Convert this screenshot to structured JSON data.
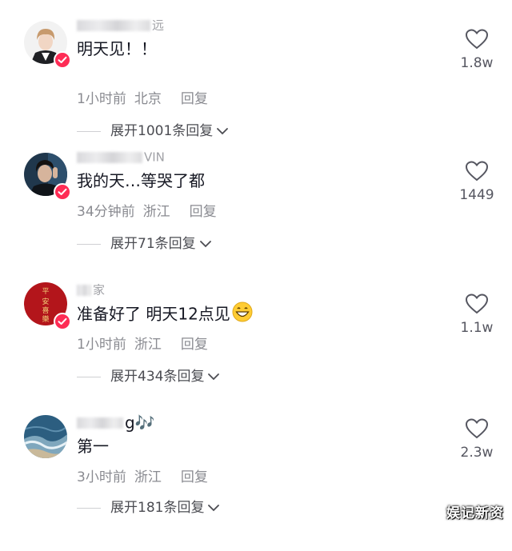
{
  "comments": [
    {
      "username_tail": "远",
      "text": "明天见！！",
      "time": "1小时前",
      "location": "北京",
      "reply_label": "回复",
      "expand_label": "展开1001条回复",
      "likes": "1.8w",
      "avatar": "young-man-portrait",
      "verified": true
    },
    {
      "username_tail": "VIN",
      "text": "我的天…等哭了都",
      "time": "34分钟前",
      "location": "浙江",
      "reply_label": "回复",
      "expand_label": "展开71条回复",
      "likes": "1449",
      "avatar": "man-dark-portrait",
      "verified": true
    },
    {
      "username_tail": "家",
      "text": "准备好了 明天12点见",
      "time": "1小时前",
      "location": "浙江",
      "reply_label": "回复",
      "expand_label": "展开434条回复",
      "likes": "1.1w",
      "avatar": "red-seal-calligraphy",
      "avatar_text": "平安喜樂",
      "verified": true,
      "emoji": "grinning-face"
    },
    {
      "username_tail": "g🎶",
      "text": "第一",
      "time": "3小时前",
      "location": "浙江",
      "reply_label": "回复",
      "expand_label": "展开181条回复",
      "likes": "2.3w",
      "avatar": "ocean-waves-aerial",
      "verified": false
    }
  ],
  "watermark": "娱记新资",
  "colors": {
    "verified": "#fe2c55",
    "meta_text": "#8a8b91",
    "body_text": "#161823"
  }
}
